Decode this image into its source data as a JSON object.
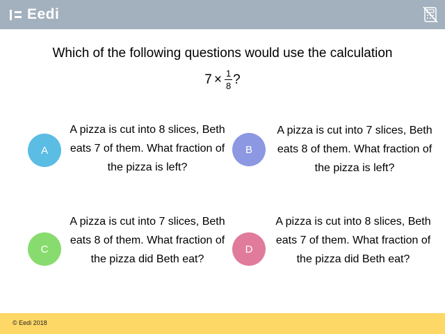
{
  "header": {
    "logo_text": "Eedi",
    "icon": "calculator-disabled-icon",
    "background": "#a3b0bd"
  },
  "question": {
    "text": "Which of the following questions would use the calculation",
    "expression": {
      "whole": "7",
      "operator": "×",
      "numerator": "1",
      "denominator": "8",
      "suffix": "?"
    }
  },
  "answers": [
    {
      "letter": "A",
      "color": "#5bbce4",
      "text": "A pizza is cut into 8 slices, Beth eats 7 of them. What fraction of the pizza is left?"
    },
    {
      "letter": "B",
      "color": "#8d98e2",
      "text": "A pizza is cut into 7 slices, Beth eats 8 of them. What fraction of the pizza is left?"
    },
    {
      "letter": "C",
      "color": "#88dc6f",
      "text": "A pizza is cut into 7 slices, Beth eats 8 of them. What fraction of the pizza did Beth eat?"
    },
    {
      "letter": "D",
      "color": "#e07b9b",
      "text": "A pizza is cut into 8 slices, Beth eats 7 of them. What fraction of the pizza did Beth eat?"
    }
  ],
  "footer": {
    "copyright": "© Eedi 2018",
    "background": "#fed866"
  }
}
